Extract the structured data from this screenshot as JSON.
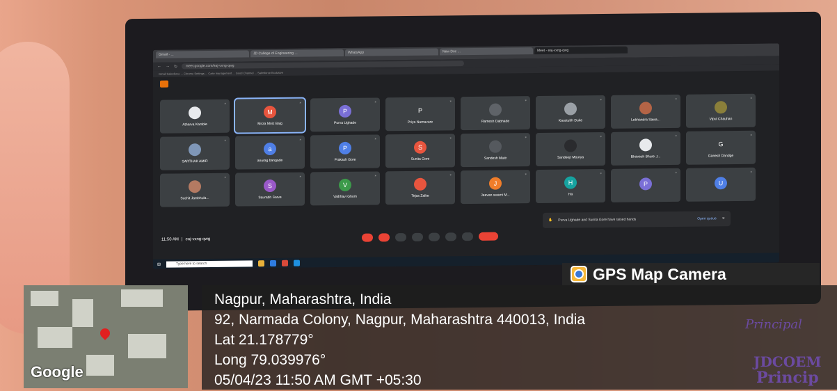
{
  "browser": {
    "tabs": [
      "Gmail - ...",
      "JD College of Engineering ...",
      "WhatsApp",
      "New Doc ...",
      "Meet - eaj-vxng-qwg"
    ],
    "url": "meet.google.com/eaj-vxng-qwg",
    "bookmarks": "Gmail  Salesforce  ...  Chrome Settings  ...  Case management  ...  Good Channel  ...  Salesforce Exclusive"
  },
  "meet": {
    "participants": [
      {
        "name": "Atharva Kamble",
        "initial": "",
        "color": "#e8eaed"
      },
      {
        "name": "Mirza Moiz Baig",
        "initial": "M",
        "color": "#e8553e",
        "speaking": true
      },
      {
        "name": "Purva Ughade",
        "initial": "P",
        "color": "#7a6fd6"
      },
      {
        "name": "Priya Narnavare",
        "initial": "P",
        "color": "#3c4043"
      },
      {
        "name": "Ramesh Dabhade",
        "initial": "",
        "color": "#5f6368"
      },
      {
        "name": "Kaustubh Duke",
        "initial": "",
        "color": "#9aa0a6"
      },
      {
        "name": "Lekhandra Sawa...",
        "initial": "",
        "color": "#b46446"
      },
      {
        "name": "Vipul Chauhan",
        "initial": "",
        "color": "#8a7f3a"
      },
      {
        "name": "SARTHAK AMIR",
        "initial": "",
        "color": "#7f97b8"
      },
      {
        "name": "anurag bangade",
        "initial": "a",
        "color": "#4f7fe6"
      },
      {
        "name": "Prakash Gore",
        "initial": "P",
        "color": "#4f7fe6"
      },
      {
        "name": "Sunita Gore",
        "initial": "S",
        "color": "#e8553e"
      },
      {
        "name": "Sandesh Mate",
        "initial": "",
        "color": "#55595e"
      },
      {
        "name": "Sandeep Mourya",
        "initial": "",
        "color": "#2a2b2e"
      },
      {
        "name": "Bhavesh Bhure ,t...",
        "initial": "",
        "color": "#e8eaed"
      },
      {
        "name": "Ganesh Dandge",
        "initial": "G",
        "color": "#3c4043"
      },
      {
        "name": "Suchit Jambhula...",
        "initial": "",
        "color": "#b47a62"
      },
      {
        "name": "Saurabh Sarve",
        "initial": "S",
        "color": "#9a59c9"
      },
      {
        "name": "Vaibhavi Ghom",
        "initial": "V",
        "color": "#3c9a4a"
      },
      {
        "name": "Tejas Zalke",
        "initial": "",
        "color": "#e8553e"
      },
      {
        "name": "Jeevan swami M...",
        "initial": "J",
        "color": "#f07d2a"
      },
      {
        "name": "Ha",
        "initial": "H",
        "color": "#16a3a0"
      },
      {
        "name": "",
        "initial": "P",
        "color": "#7a6fd6"
      },
      {
        "name": "",
        "initial": "U",
        "color": "#4f7fe6"
      }
    ],
    "time": "11:50 AM",
    "meeting_code": "eaj-vxng-qwg",
    "separator": "|",
    "toast": {
      "text": "Purva Ughade and Sunita Gore have raised hands",
      "action": "Open queue",
      "close": "✕"
    },
    "taskbar_search": "Type here to search"
  },
  "overlay": {
    "app_title": "GPS Map Camera",
    "city_line": "Nagpur, Maharashtra, India",
    "address": "92, Narmada Colony, Nagpur, Maharashtra 440013, India",
    "lat": "Lat 21.178779°",
    "long": "Long 79.039976°",
    "datetime": "05/04/23 11:50 AM GMT +05:30",
    "map_brand": "Google"
  },
  "stamp": {
    "principal": "Principal",
    "institute": "JDCOEM",
    "principal_short": "Princip"
  }
}
